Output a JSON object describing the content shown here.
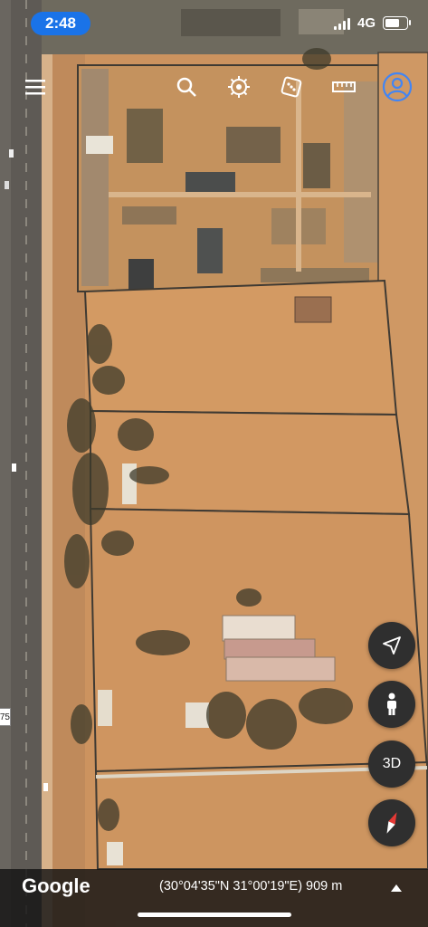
{
  "status_bar": {
    "time": "2:48",
    "network": "4G",
    "battery_level": 0.75,
    "time_bg": "#1a73e8"
  },
  "toolbar": {
    "icons": [
      "menu-icon",
      "search-icon",
      "voyager-icon",
      "feeling-lucky-icon",
      "measure-icon",
      "account-icon"
    ]
  },
  "map": {
    "type": "satellite",
    "road_label": "75",
    "ground_color": "#c98f5a"
  },
  "controls": {
    "three_d_label": "3D",
    "icons": [
      "location-arrow-icon",
      "pegman-icon",
      "compass-icon"
    ]
  },
  "bottom_bar": {
    "logo": "Google",
    "coordinates": "(30°04'35\"N 31°00'19\"E) 909 m"
  }
}
